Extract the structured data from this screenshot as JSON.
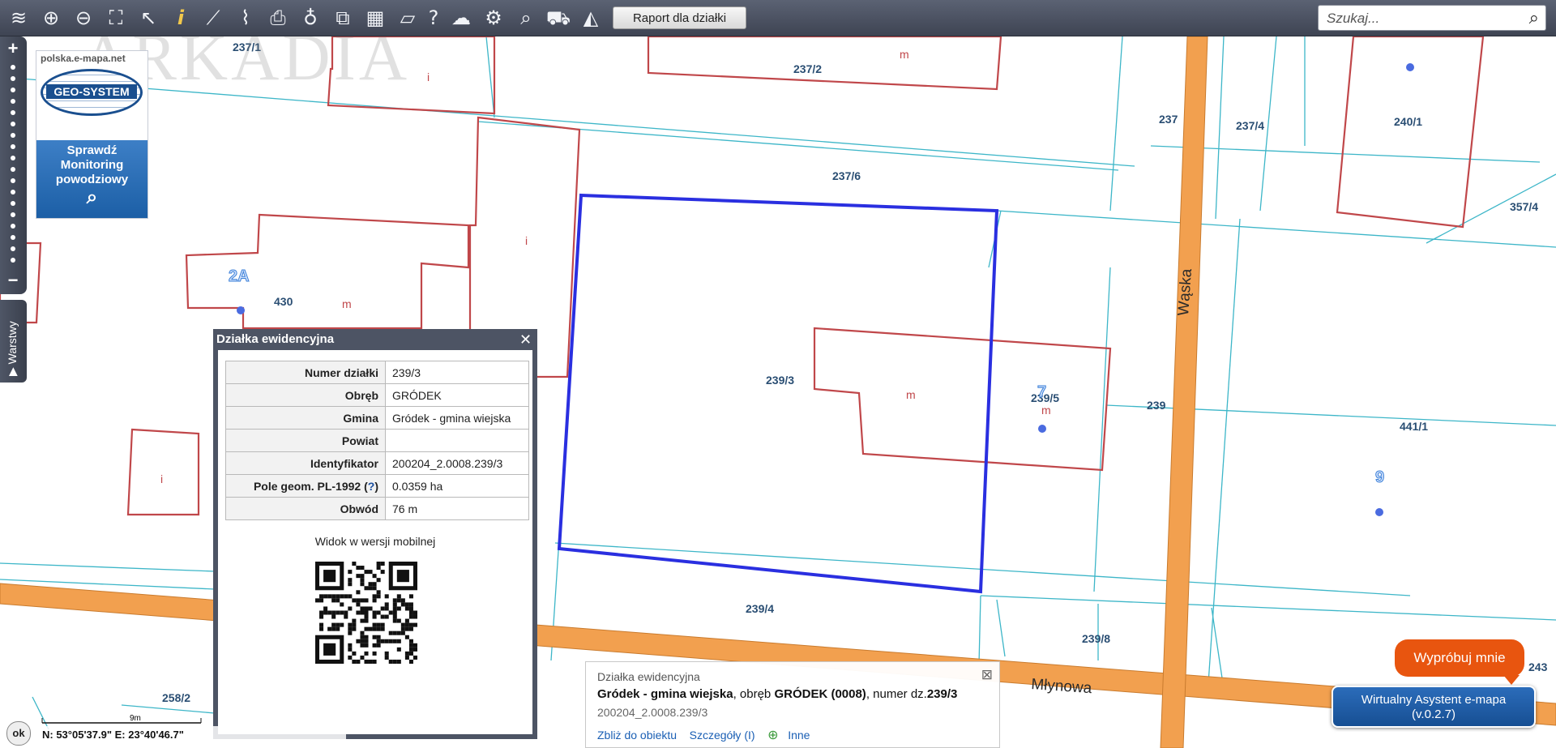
{
  "toolbar": {
    "icons": [
      "layers-icon",
      "zoom-in-icon",
      "zoom-out-icon",
      "zoom-extent-icon",
      "pointer-icon",
      "info-icon",
      "measure-line-icon",
      "measure-area-icon",
      "print-icon",
      "pin-icon",
      "overview-icon",
      "layout-icon",
      "map-shape-icon",
      "help-icon",
      "cloud-upload-icon",
      "settings-icon",
      "search-zoom-icon",
      "cart-icon",
      "warning-icon"
    ],
    "report_label": "Raport dla działki",
    "search_placeholder": "Szukaj..."
  },
  "sidebar": {
    "layers_label": "Warstwy"
  },
  "banner": {
    "site": "polska.e-mapa.net",
    "brand": "GEO-SYSTEM",
    "line1": "Sprawdź",
    "line2": "Monitoring",
    "line3": "powodziowy"
  },
  "watermark": "ARKADIA",
  "map_labels": {
    "l_237_1": "237/1",
    "l_237_2": "237/2",
    "l_237": "237",
    "l_237_4": "237/4",
    "l_240_1": "240/1",
    "l_237_6": "237/6",
    "l_357_4": "357/4",
    "l_2A": "2A",
    "l_430": "430",
    "l_239_3": "239/3",
    "l_239_5": "239/5",
    "l_239": "239",
    "l_441_1": "441/1",
    "l_9": "9",
    "l_7": "7",
    "l_239_4": "239/4",
    "l_239_8": "239/8",
    "l_243": "243",
    "l_258_2": "258/2",
    "street_waska": "Wąska",
    "street_mlynowa": "Młynowa",
    "m": "m",
    "i": "i"
  },
  "popup": {
    "title": "Działka ewidencyjna",
    "rows": [
      {
        "label": "Numer działki",
        "value": "239/3"
      },
      {
        "label": "Obręb",
        "value": "GRÓDEK"
      },
      {
        "label": "Gmina",
        "value": "Gródek - gmina wiejska"
      },
      {
        "label": "Powiat",
        "value": ""
      },
      {
        "label": "Identyfikator",
        "value": "200204_2.0008.239/3"
      },
      {
        "label": "Pole geom. PL-1992 (",
        "value": "0.0359 ha"
      },
      {
        "label": "Obwód",
        "value": "76 m"
      }
    ],
    "help_link": "?",
    "help_suffix": ")",
    "mobile_text": "Widok w wersji mobilnej"
  },
  "infopanel": {
    "type": "Działka ewidencyjna",
    "gmina": "Gródek - gmina wiejska",
    "obreb_prefix": ", obręb ",
    "obreb": "GRÓDEK (0008)",
    "numer_prefix": ", numer dz.",
    "numer": "239/3",
    "identifier": "200204_2.0008.239/3",
    "link_zoom": "Zbliż do obiektu",
    "link_details": "Szczegóły (I)",
    "link_other": "Inne"
  },
  "assistant": {
    "try_label": "Wypróbuj mnie",
    "line1": "Wirtualny Asystent e-mapa",
    "line2": "(v.0.2.7)"
  },
  "status": {
    "scale_label": "9m",
    "coords": "N: 53°05'37.9\" E: 23°40'46.7\"",
    "ok_label": "ok"
  },
  "colors": {
    "parcel_line": "#39b8c9",
    "building_line": "#c0474a",
    "highlight": "#2a2fe0",
    "road": "#f2a04f",
    "label": "#2a4e73"
  }
}
